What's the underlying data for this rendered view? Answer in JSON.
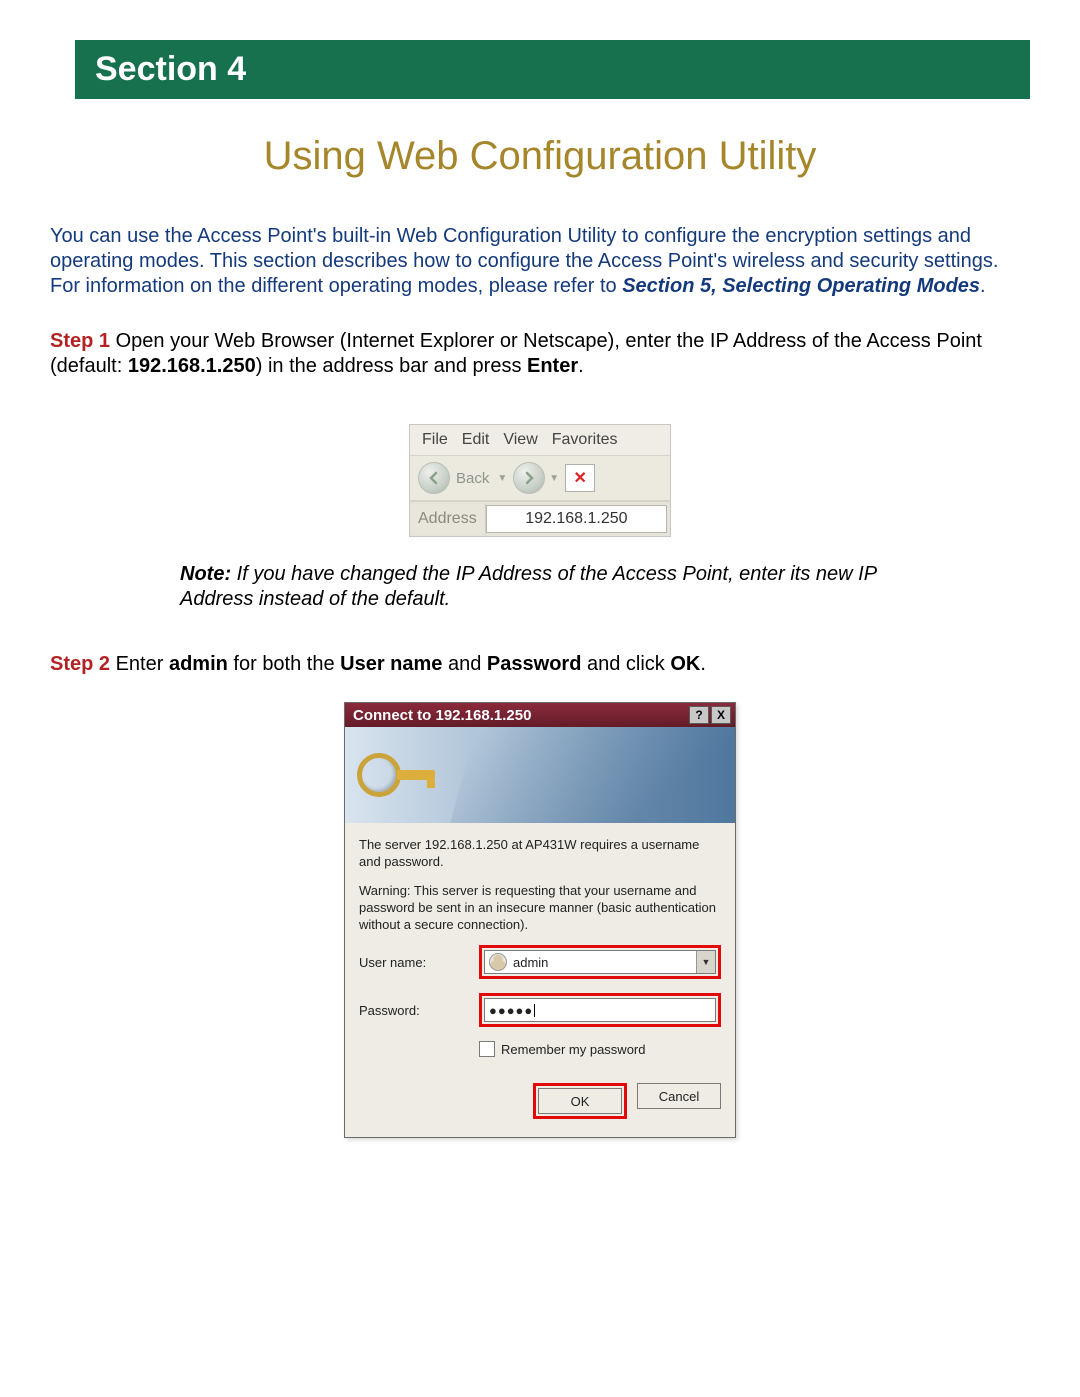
{
  "header": {
    "section_label": "Section 4"
  },
  "title": "Using Web Configuration Utility",
  "intro": {
    "text": "You can use the Access Point's built-in Web Configuration Utility to configure the encryption settings and operating modes. This section describes how to configure the Access Point's wireless and security settings. For information on the different operating modes, please refer to ",
    "ref": "Section 5, Selecting Operating Modes",
    "tail": "."
  },
  "step1": {
    "label": "Step 1",
    "text_a": " Open your Web Browser (Internet Explorer or Netscape), enter the IP Address of the Access Point (default: ",
    "ip": "192.168.1.250",
    "text_b": ") in the address bar and press ",
    "enter": "Enter",
    "text_c": "."
  },
  "browser": {
    "menu": {
      "file": "File",
      "edit": "Edit",
      "view": "View",
      "favorites": "Favorites"
    },
    "back_label": "Back",
    "address_label": "Address",
    "address_value": "192.168.1.250"
  },
  "note": {
    "label": "Note:",
    "text": " If you have changed the IP Address of the Access Point, enter its new IP Address instead of the default."
  },
  "step2": {
    "label": "Step 2",
    "t1": " Enter ",
    "admin": "admin",
    "t2": " for both the ",
    "user": "User name",
    "t3": " and ",
    "pass": "Password",
    "t4": " and click ",
    "ok": "OK",
    "t5": "."
  },
  "dialog": {
    "title": "Connect to 192.168.1.250",
    "msg1": "The server 192.168.1.250 at AP431W requires a username and password.",
    "msg2": "Warning: This server is requesting that your username and password be sent in an insecure manner (basic authentication without a secure connection).",
    "user_label": "User name:",
    "user_value": "admin",
    "pass_label": "Password:",
    "pass_dots": "●●●●●",
    "remember": "Remember my password",
    "ok": "OK",
    "cancel": "Cancel",
    "help": "?",
    "close": "X"
  }
}
